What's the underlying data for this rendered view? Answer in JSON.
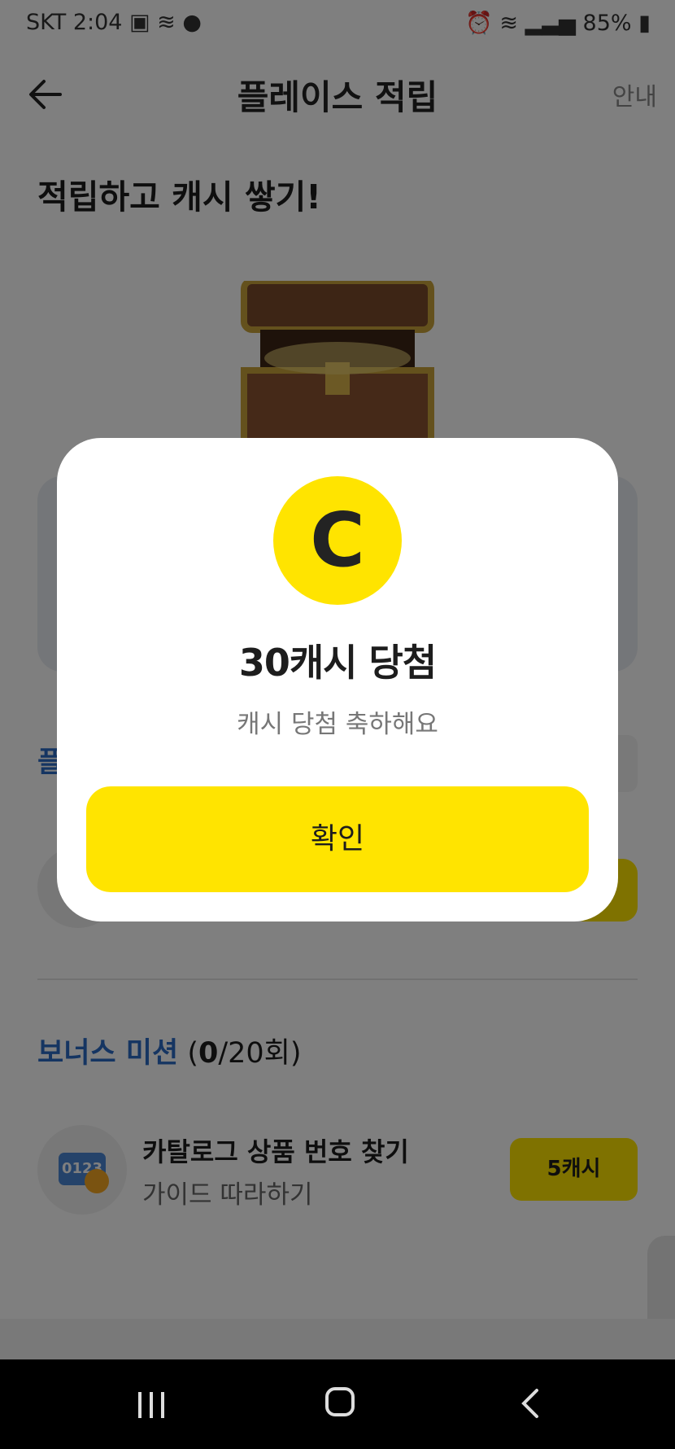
{
  "status_bar": {
    "carrier": "SKT",
    "time": "2:04",
    "battery": "85%"
  },
  "header": {
    "title": "플레이스 적립",
    "info": "안내"
  },
  "headline": "적립하고 캐시 쌓기!",
  "section_peek": "플",
  "bonus": {
    "label": "보너스 미션",
    "count_prefix": "(",
    "count_done": "0",
    "count_rest": "/20회)"
  },
  "mission": {
    "icon_text": "0123",
    "title": "카탈로그 상품 번호 찾기",
    "subtitle": "가이드 따라하기",
    "reward": "5캐시"
  },
  "modal": {
    "coin_letter": "C",
    "title": "30캐시 당첨",
    "subtitle": "캐시 당첨 축하해요",
    "confirm": "확인"
  },
  "colors": {
    "accent_yellow": "#ffe400",
    "accent_blue": "#2b6bc4"
  }
}
